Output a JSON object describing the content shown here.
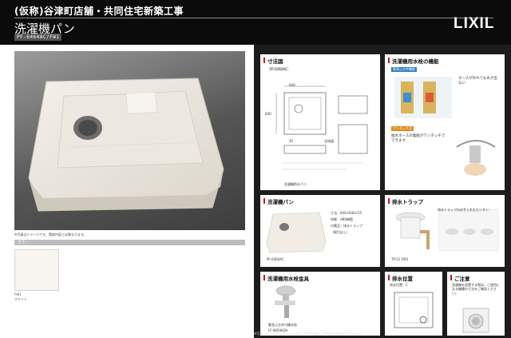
{
  "header": {
    "project": "(仮称)谷津町店舗・共同住宅新築工事",
    "product_title": "洗濯機パン",
    "product_code": "PF-6464AC/FW1",
    "logo": "LIXIL"
  },
  "main": {
    "photo_caption": "※写真はイメージです。実物内容とは異なります。",
    "color_label": "カラー",
    "color_code": "FW1",
    "color_name": "ホワイト",
    "color_hex": "#f8f4ef"
  },
  "cards": {
    "dimensions": {
      "title": "寸法図",
      "code": "PF-6464AC",
      "w1": "640",
      "h1": "640",
      "depth": "45",
      "note1": "全体図",
      "note2": "洗濯機防水パン"
    },
    "faucet_function": {
      "title": "洗濯機用水栓の機能",
      "tag1": "緊急止水弁機能",
      "tag2": "ワンタッチ式",
      "desc1": "ホースが外れても水が出ない",
      "desc2": "給水ホースの着脱がワンタッチでできます"
    },
    "washer_pan": {
      "title": "洗濯機パン",
      "code": "PF-6464AC",
      "spec1": "寸法：640×640×55",
      "spec2": "材質：ABS樹脂",
      "spec3": "付属品：排水トラップ",
      "spec4": "（縦引出し）"
    },
    "drain_trap": {
      "title": "排水トラップ",
      "desc1": "排水トラップのお手入れもカンタン",
      "code": "TP-51 FW1"
    },
    "faucet_parts": {
      "title": "洗濯機用水栓金具",
      "code": "LF-WJ50KQA",
      "desc": "緊急止水弁付横水栓"
    },
    "drain_position": {
      "title": "排水位置",
      "label": "排水位置：C"
    },
    "notice": {
      "title": "ご注意",
      "desc": "洗濯機を設置する際は、ご使用になる機種の寸法をご確認ください。"
    }
  },
  "footer_note": "※写真・イラストはイメージです。実際の施工とは異なる場合がございます。"
}
